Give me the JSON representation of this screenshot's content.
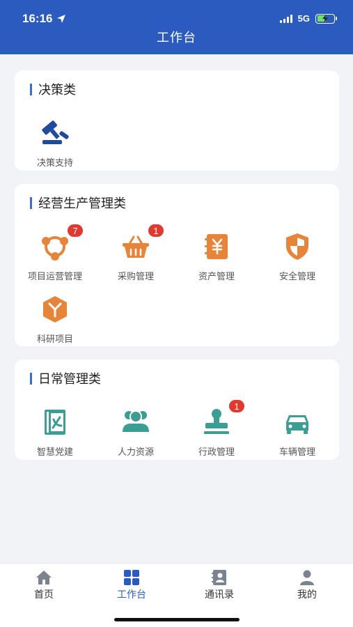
{
  "status_bar": {
    "time": "16:16",
    "network": "5G"
  },
  "header": {
    "title": "工作台"
  },
  "sections": [
    {
      "title": "决策类",
      "items": [
        {
          "label": "决策支持",
          "icon": "gavel-icon",
          "badge": ""
        }
      ]
    },
    {
      "title": "经营生产管理类",
      "items": [
        {
          "label": "项目运营管理",
          "icon": "cycle-icon",
          "badge": "7"
        },
        {
          "label": "采购管理",
          "icon": "basket-icon",
          "badge": "1"
        },
        {
          "label": "资产管理",
          "icon": "yuan-notebook-icon",
          "badge": ""
        },
        {
          "label": "安全管理",
          "icon": "shield-icon",
          "badge": ""
        },
        {
          "label": "科研项目",
          "icon": "box-icon",
          "badge": ""
        }
      ]
    },
    {
      "title": "日常管理类",
      "items": [
        {
          "label": "智慧党建",
          "icon": "party-book-icon",
          "badge": ""
        },
        {
          "label": "人力资源",
          "icon": "people-icon",
          "badge": ""
        },
        {
          "label": "行政管理",
          "icon": "stamp-icon",
          "badge": "1"
        },
        {
          "label": "车辆管理",
          "icon": "car-icon",
          "badge": ""
        }
      ]
    }
  ],
  "tabbar": {
    "items": [
      {
        "label": "首页",
        "icon": "home-icon"
      },
      {
        "label": "工作台",
        "icon": "grid-icon"
      },
      {
        "label": "通讯录",
        "icon": "contacts-icon"
      },
      {
        "label": "我的",
        "icon": "user-icon"
      }
    ],
    "active": "工作台"
  },
  "colors": {
    "header": "#2b5bbf",
    "orange": "#e8843a",
    "teal": "#3a9e94",
    "navy": "#1f4aa0",
    "badge": "#e03a30"
  }
}
